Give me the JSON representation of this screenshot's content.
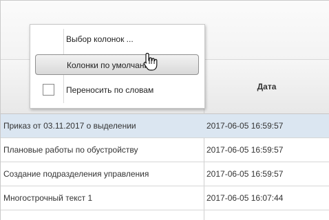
{
  "menu": {
    "choose_columns": "Выбор колонок ...",
    "default_columns": "Колонки по умолчанию",
    "wrap_words": "Переносить по словам"
  },
  "table": {
    "header_date": "Дата",
    "rows": [
      {
        "title": "Приказ от 03.11.2017 о выделении",
        "date": "2017-06-05 16:59:57",
        "selected": true
      },
      {
        "title": "Плановые работы по обустройству",
        "date": "2017-06-05 16:59:57",
        "selected": false
      },
      {
        "title": "Создание подразделения управления",
        "date": "2017-06-05 16:59:57",
        "selected": false
      },
      {
        "title": "Многострочный текст 1",
        "date": "2017-06-05 16:07:44",
        "selected": false
      }
    ]
  },
  "icons": {
    "cursor": "hand-pointer-icon",
    "checkbox": "unchecked-checkbox-icon"
  }
}
